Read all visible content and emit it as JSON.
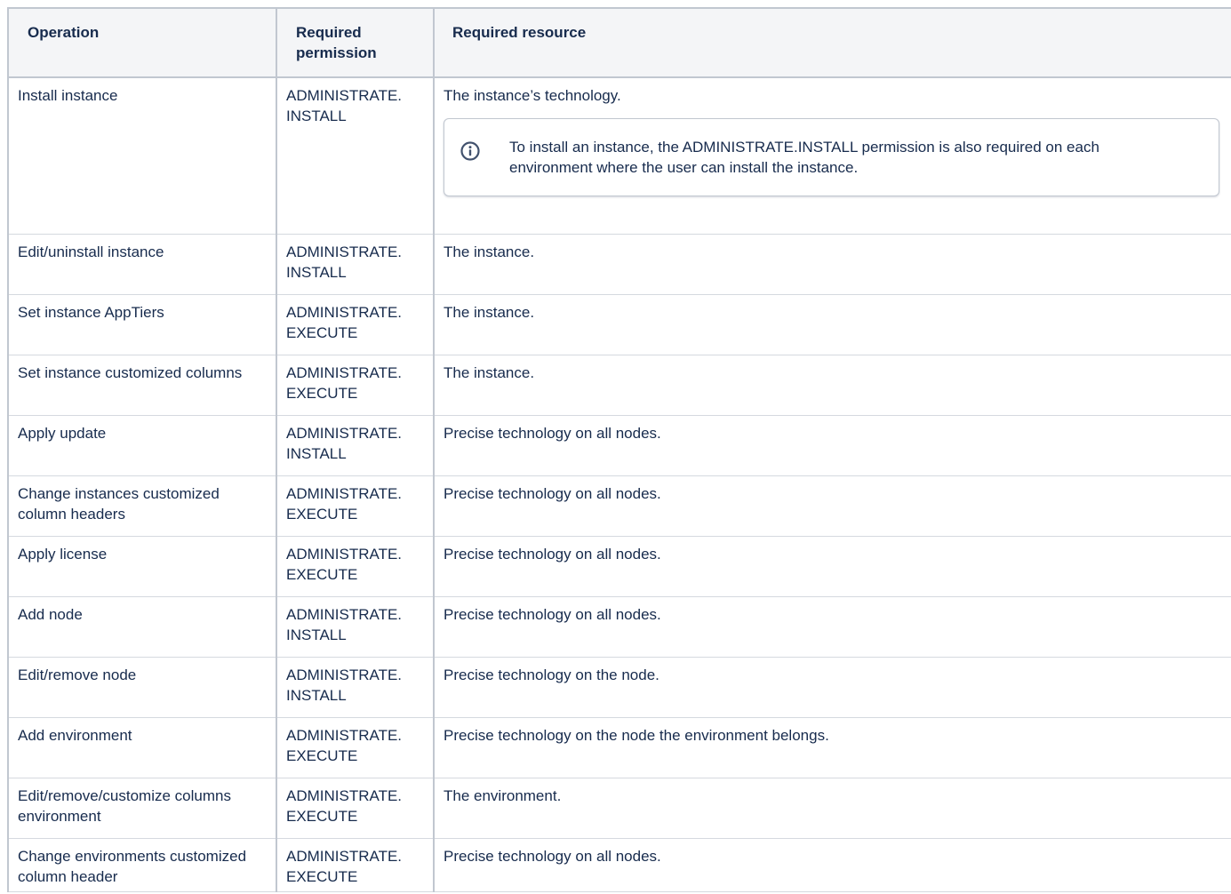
{
  "table": {
    "headers": {
      "operation": "Operation",
      "permission": "Required permission",
      "resource": "Required resource"
    },
    "rows": [
      {
        "operation": "Install instance",
        "permission": "ADMINISTRATE.\nINSTALL",
        "resource": "The instance’s technology.",
        "note": "To install an instance, the ADMINISTRATE.INSTALL permission is also required on each environment where the user can install the instance."
      },
      {
        "operation": "Edit/uninstall instance",
        "permission": "ADMINISTRATE.\nINSTALL",
        "resource": "The instance."
      },
      {
        "operation": "Set instance AppTiers",
        "permission": "ADMINISTRATE.\nEXECUTE",
        "resource": "The instance."
      },
      {
        "operation": "Set instance customized columns",
        "permission": "ADMINISTRATE.\nEXECUTE",
        "resource": "The instance."
      },
      {
        "operation": "Apply update",
        "permission": "ADMINISTRATE.\nINSTALL",
        "resource": "Precise technology on all nodes."
      },
      {
        "operation": "Change instances customized column headers",
        "permission": "ADMINISTRATE.\nEXECUTE",
        "resource": "Precise technology on all nodes."
      },
      {
        "operation": "Apply license",
        "permission": "ADMINISTRATE.\nEXECUTE",
        "resource": "Precise technology on all nodes."
      },
      {
        "operation": "Add node",
        "permission": "ADMINISTRATE.\nINSTALL",
        "resource": "Precise technology on all nodes."
      },
      {
        "operation": "Edit/remove node",
        "permission": "ADMINISTRATE.\nINSTALL",
        "resource": "Precise technology on the node."
      },
      {
        "operation": "Add environment",
        "permission": "ADMINISTRATE.\nEXECUTE",
        "resource": "Precise technology on the node the environment belongs."
      },
      {
        "operation": "Edit/remove/customize columns environment",
        "permission": "ADMINISTRATE.\nEXECUTE",
        "resource": "The environment."
      },
      {
        "operation": "Change environments customized column header",
        "permission": "ADMINISTRATE.\nEXECUTE",
        "resource": "Precise technology on all nodes."
      }
    ]
  },
  "icons": {
    "note_icon": "info-circle-icon"
  },
  "colors": {
    "header_bg": "#f4f5f7",
    "border": "#c1c7d0",
    "text": "#172b4d"
  }
}
